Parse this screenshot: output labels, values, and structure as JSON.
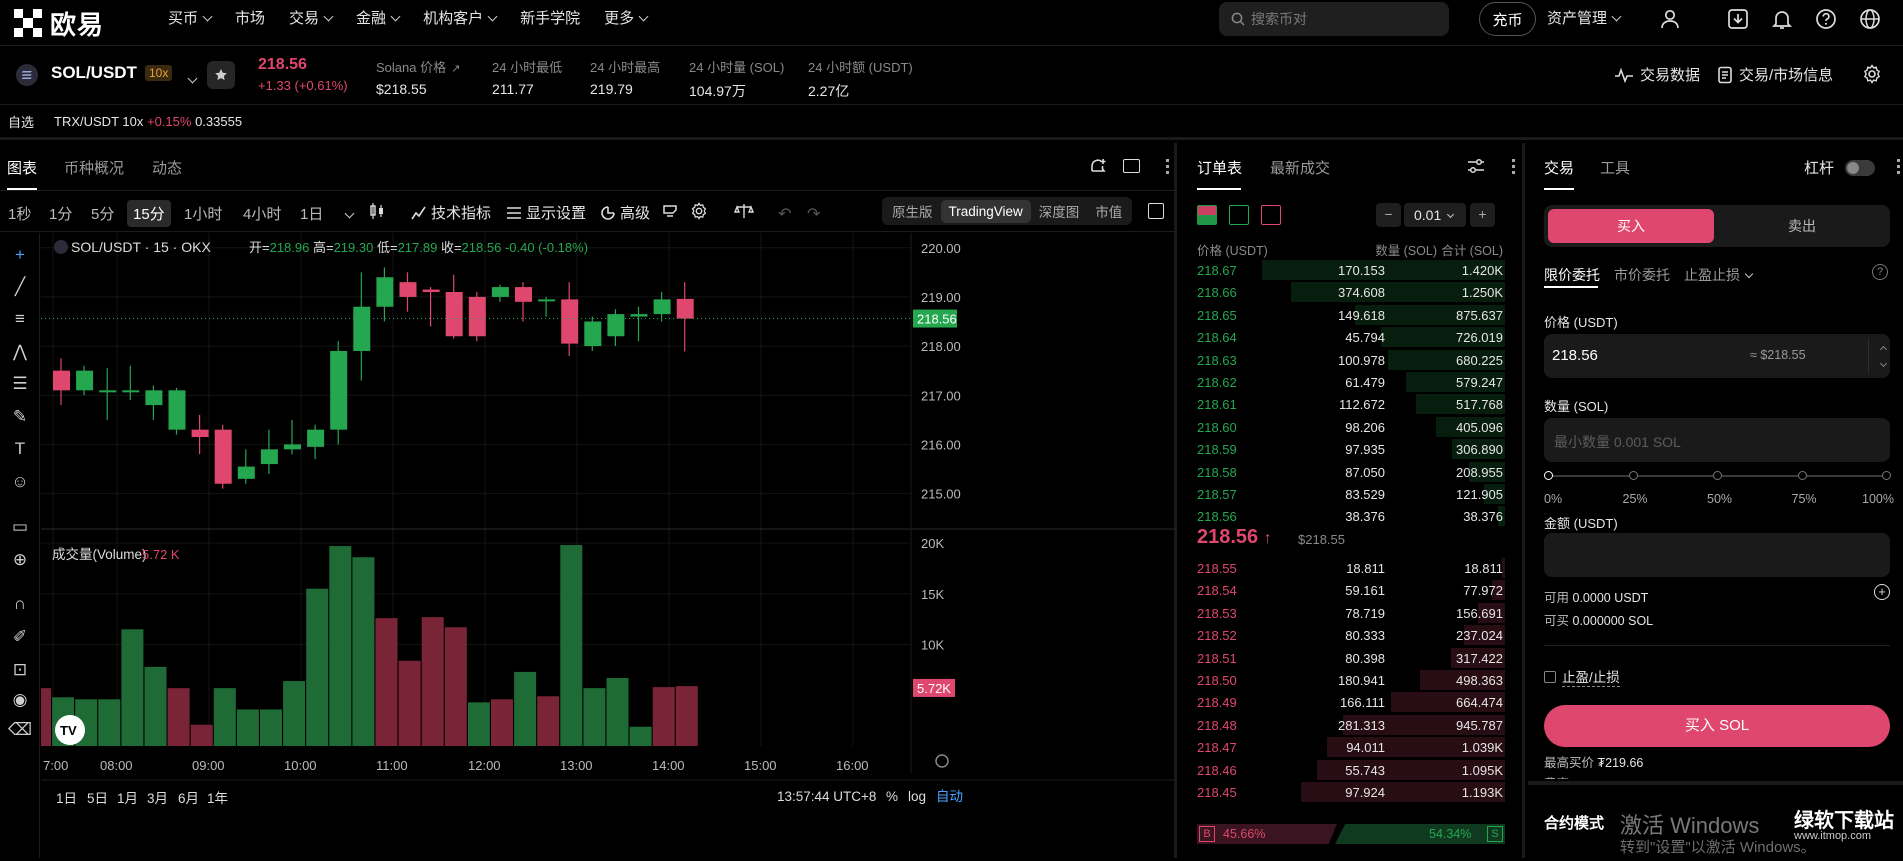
{
  "nav": {
    "logo_text": "欧易",
    "menu": [
      "买币",
      "市场",
      "交易",
      "金融",
      "机构客户",
      "新手学院",
      "更多"
    ],
    "menu_has_chevron": [
      true,
      false,
      true,
      true,
      true,
      false,
      true
    ],
    "search_placeholder": "搜索币对",
    "recharge_label": "充币",
    "assets_label": "资产管理"
  },
  "ticker": {
    "pair": "SOL/USDT",
    "leverage": "10x",
    "last_price": "218.56",
    "change": "+1.33 (+0.61%)",
    "stats": [
      {
        "label": "Solana 价格",
        "value": "$218.55"
      },
      {
        "label": "24 小时最低",
        "value": "211.77"
      },
      {
        "label": "24 小时最高",
        "value": "219.79"
      },
      {
        "label": "24 小时量 (SOL)",
        "value": "104.97万"
      },
      {
        "label": "24 小时额 (USDT)",
        "value": "2.27亿"
      }
    ],
    "trade_data_label": "交易数据",
    "market_info_label": "交易/市场信息"
  },
  "favorites": {
    "label": "自选",
    "item_pair": "TRX/USDT 10x",
    "item_change": "+0.15%",
    "item_price": "0.33555"
  },
  "chart_tabs": [
    "图表",
    "币种概况",
    "动态"
  ],
  "timeframes": [
    "1秒",
    "1分",
    "5分",
    "15分",
    "1小时",
    "4小时",
    "1日"
  ],
  "selected_timeframe": "15分",
  "toolbar": {
    "indicators": "技术指标",
    "display": "显示设置",
    "advanced": "高级"
  },
  "view_modes": [
    "原生版",
    "TradingView",
    "深度图",
    "市值"
  ],
  "selected_view": "TradingView",
  "chart_data": {
    "type": "candlestick",
    "title": "SOL/USDT · 15 · OKX",
    "ohlc_line": {
      "open": "218.96",
      "high": "219.30",
      "low": "217.89",
      "close": "218.56",
      "change": "-0.40 (-0.18%)"
    },
    "ohlc_labels": {
      "open": "开=",
      "high": "高=",
      "low": "低=",
      "close": "收="
    },
    "price_axis": [
      "220.00",
      "219.00",
      "218.00",
      "217.00",
      "216.00",
      "215.00"
    ],
    "price_range": [
      214.3,
      220.3
    ],
    "current_price": "218.56",
    "time_axis": [
      "7:00",
      "08:00",
      "09:00",
      "10:00",
      "11:00",
      "12:00",
      "13:00",
      "14:00",
      "15:00",
      "16:00"
    ],
    "candles": [
      [
        217.5,
        217.1,
        217.75,
        216.8
      ],
      [
        217.1,
        217.5,
        217.6,
        217.0
      ],
      [
        217.1,
        217.1,
        217.55,
        216.5
      ],
      [
        217.1,
        217.1,
        217.6,
        216.9
      ],
      [
        216.8,
        217.1,
        217.2,
        216.5
      ],
      [
        216.3,
        217.1,
        217.15,
        216.2
      ],
      [
        216.3,
        216.15,
        216.6,
        215.8
      ],
      [
        216.3,
        215.2,
        216.4,
        215.1
      ],
      [
        215.3,
        215.55,
        215.9,
        215.2
      ],
      [
        215.6,
        215.9,
        216.3,
        215.4
      ],
      [
        215.9,
        216.0,
        216.5,
        215.8
      ],
      [
        215.95,
        216.3,
        216.4,
        215.7
      ],
      [
        216.3,
        217.9,
        218.1,
        216.0
      ],
      [
        217.9,
        218.8,
        219.5,
        217.3
      ],
      [
        218.8,
        219.4,
        219.6,
        218.5
      ],
      [
        219.3,
        219.0,
        219.5,
        218.7
      ],
      [
        219.15,
        219.1,
        219.2,
        218.4
      ],
      [
        219.1,
        218.2,
        219.45,
        218.15
      ],
      [
        219.0,
        218.2,
        219.1,
        218.1
      ],
      [
        219.0,
        219.2,
        219.25,
        218.9
      ],
      [
        219.2,
        218.9,
        219.3,
        218.5
      ],
      [
        218.95,
        218.95,
        219.0,
        218.6
      ],
      [
        218.95,
        218.05,
        219.3,
        217.8
      ],
      [
        218.0,
        218.5,
        218.6,
        217.9
      ],
      [
        218.2,
        218.65,
        218.75,
        218.0
      ],
      [
        218.6,
        218.65,
        218.8,
        218.1
      ],
      [
        218.65,
        218.95,
        219.1,
        218.5
      ],
      [
        218.96,
        218.56,
        219.3,
        217.89
      ]
    ],
    "volume_label": "成交量(Volume)",
    "volume_value": "5.72 K",
    "volume_axis": [
      "20K",
      "15K",
      "10K"
    ],
    "volume_max": 20000,
    "volumes": [
      5700,
      4800,
      4600,
      4600,
      11500,
      7800,
      5700,
      2100,
      5700,
      3600,
      3600,
      6400,
      15500,
      19700,
      18600,
      12600,
      8400,
      12700,
      11700,
      4300,
      4600,
      7300,
      4900,
      19800,
      5700,
      6700,
      1900,
      5800,
      5900
    ],
    "current_volume": "5.72K",
    "time_display": "13:57:44 UTC+8",
    "period_buttons": [
      "1日",
      "5日",
      "1月",
      "3月",
      "6月",
      "1年"
    ],
    "scale_buttons": [
      "%",
      "log",
      "自动"
    ]
  },
  "orderbook": {
    "tabs": [
      "订单表",
      "最新成交"
    ],
    "step": "0.01",
    "headers": [
      "价格 (USDT)",
      "数量 (SOL)",
      "合计 (SOL)"
    ],
    "asks": [
      [
        "218.67",
        "170.153",
        "1.420K"
      ],
      [
        "218.66",
        "374.608",
        "1.250K"
      ],
      [
        "218.65",
        "149.618",
        "875.637"
      ],
      [
        "218.64",
        "45.794",
        "726.019"
      ],
      [
        "218.63",
        "100.978",
        "680.225"
      ],
      [
        "218.62",
        "61.479",
        "579.247"
      ],
      [
        "218.61",
        "112.672",
        "517.768"
      ],
      [
        "218.60",
        "98.206",
        "405.096"
      ],
      [
        "218.59",
        "97.935",
        "306.890"
      ],
      [
        "218.58",
        "87.050",
        "208.955"
      ],
      [
        "218.57",
        "83.529",
        "121.905"
      ],
      [
        "218.56",
        "38.376",
        "38.376"
      ]
    ],
    "mid_price": "218.56",
    "mid_arrow": "↑",
    "mid_usd": "$218.55",
    "bids": [
      [
        "218.55",
        "18.811",
        "18.811"
      ],
      [
        "218.54",
        "59.161",
        "77.972"
      ],
      [
        "218.53",
        "78.719",
        "156.691"
      ],
      [
        "218.52",
        "80.333",
        "237.024"
      ],
      [
        "218.51",
        "80.398",
        "317.422"
      ],
      [
        "218.50",
        "180.941",
        "498.363"
      ],
      [
        "218.49",
        "166.111",
        "664.474"
      ],
      [
        "218.48",
        "281.313",
        "945.787"
      ],
      [
        "218.47",
        "94.011",
        "1.039K"
      ],
      [
        "218.46",
        "55.743",
        "1.095K"
      ],
      [
        "218.45",
        "97.924",
        "1.193K"
      ]
    ],
    "bid_pct": "45.66%",
    "ask_pct": "54.34%",
    "bid_tag": "B",
    "ask_tag": "S"
  },
  "trade": {
    "tabs": [
      "交易",
      "工具"
    ],
    "leverage_label": "杠杆",
    "buy_label": "买入",
    "sell_label": "卖出",
    "order_types": [
      "限价委托",
      "市价委托",
      "止盈止损"
    ],
    "price_label": "价格 (USDT)",
    "price_value": "218.56",
    "price_usd": "≈ $218.55",
    "qty_label": "数量 (SOL)",
    "qty_placeholder": "最小数量 0.001 SOL",
    "slider_marks": [
      "0%",
      "25%",
      "50%",
      "75%",
      "100%"
    ],
    "amount_label": "金额 (USDT)",
    "available_label": "可用",
    "available_value": "0.0000 USDT",
    "buyable_label": "可买",
    "buyable_value": "0.000000 SOL",
    "tpsl_label": "止盈/止损",
    "submit_label": "买入 SOL",
    "max_buy_label": "最高买价",
    "max_buy_value": "₮219.66",
    "fee_label": "费率",
    "contract_mode_label": "合约模式"
  },
  "overlay": {
    "activate_line1": "激活 Windows",
    "activate_line2": "转到\"设置\"以激活 Windows。",
    "site_name": "绿软下载站",
    "site_url": "www.itmop.com"
  },
  "colors": {
    "green": "#25a750",
    "red": "#e0476e",
    "bg": "#000000",
    "panel": "#1a1a1a"
  }
}
